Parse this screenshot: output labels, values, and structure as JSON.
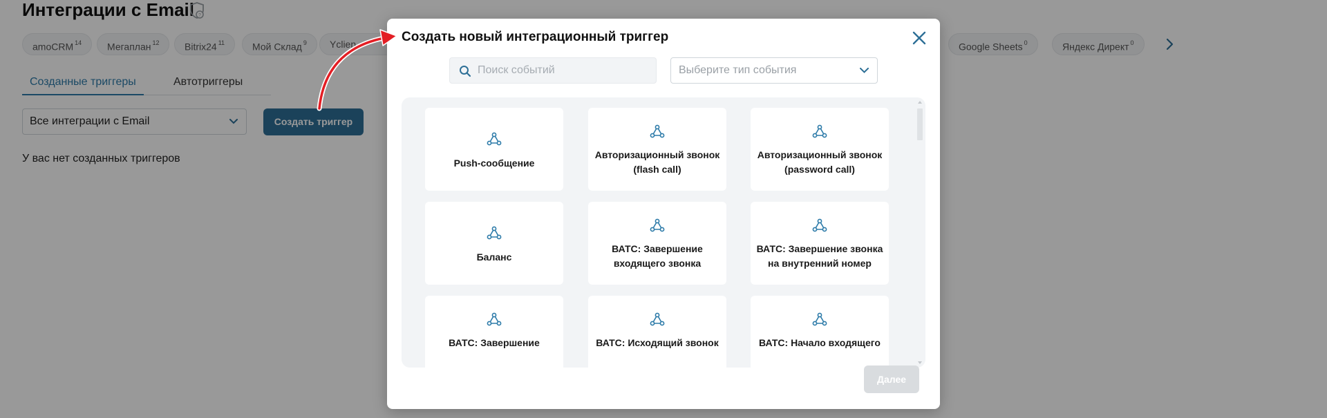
{
  "page": {
    "title": "Интеграции с Email",
    "integrations": [
      {
        "name": "amoCRM",
        "count": "14"
      },
      {
        "name": "Мегаплан",
        "count": "12"
      },
      {
        "name": "Bitrix24",
        "count": "11"
      },
      {
        "name": "Мой Склад",
        "count": "9"
      },
      {
        "name": "Yclien",
        "count": ""
      },
      {
        "name": "Google Sheets",
        "count": "0"
      },
      {
        "name": "Яндекс Директ",
        "count": "0"
      }
    ],
    "tabs": [
      "Созданные триггеры",
      "Автотриггеры"
    ],
    "integration_filter_value": "Все интеграции с Email",
    "create_button_label": "Создать триггер",
    "empty_state_text": "У вас нет созданных триггеров"
  },
  "modal": {
    "title": "Создать новый интеграционный триггер",
    "search_placeholder": "Поиск событий",
    "type_placeholder": "Выберите тип события",
    "cards": [
      "Push-сообщение",
      "Авторизационный звонок (flash call)",
      "Авторизационный звонок (password call)",
      "Баланс",
      "ВАТС: Завершение входящего звонка",
      "ВАТС: Завершение звонка на внутренний номер",
      "ВАТС: Завершение",
      "ВАТС: Исходящий звонок",
      "ВАТС: Начало входящего"
    ],
    "next_button_label": "Далее"
  },
  "colors": {
    "accent": "#2d7ba9",
    "primary_button": "#2d6f96",
    "disabled_button": "#d9dcdf",
    "annotation_arrow": "#e31e24",
    "overlay": "rgba(0,0,0,0.40)"
  }
}
